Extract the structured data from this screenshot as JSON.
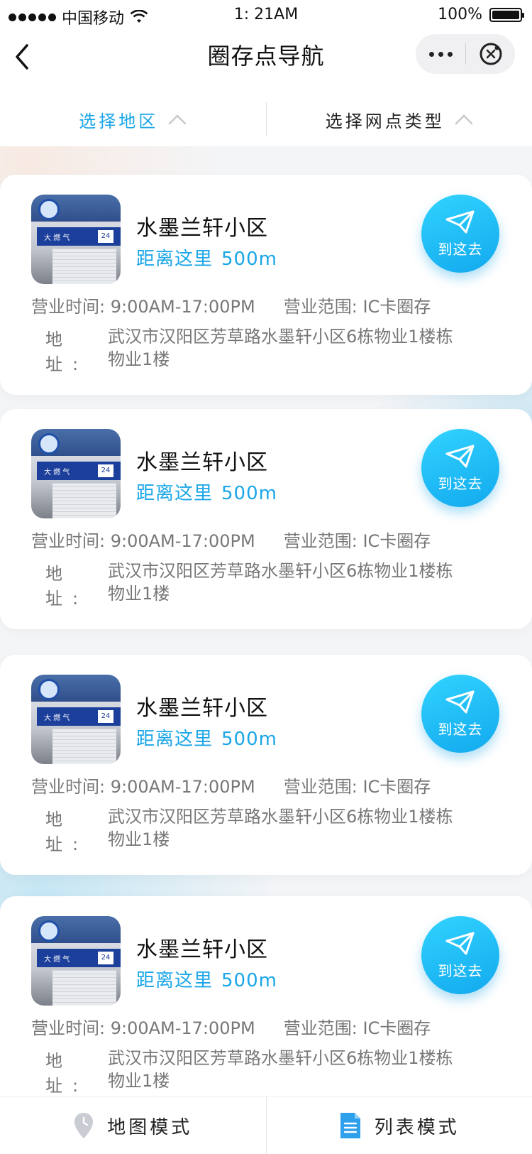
{
  "status_bar": {
    "carrier": "中国移动",
    "time": "1: 21AM",
    "battery": "100%",
    "battery_level": 1.0
  },
  "nav": {
    "title": "圈存点导航"
  },
  "filters": [
    {
      "label": "选择地区",
      "active": true
    },
    {
      "label": "选择网点类型",
      "active": false
    }
  ],
  "cards": [
    {
      "name": "水墨兰轩小区",
      "distance_label": "距离这里",
      "distance_value": "500m",
      "go_label": "到这去",
      "hours": "营业时间: 9:00AM-17:00PM",
      "scope": "营业范围: IC卡圈存",
      "address_label": "地址:",
      "address": "武汉市汉阳区芳草路水墨轩小区6栋物业1楼栋物业1楼",
      "photo_sign": "大 燃 气",
      "photo_badge": "24"
    },
    {
      "name": "水墨兰轩小区",
      "distance_label": "距离这里",
      "distance_value": "500m",
      "go_label": "到这去",
      "hours": "营业时间: 9:00AM-17:00PM",
      "scope": "营业范围: IC卡圈存",
      "address_label": "地址:",
      "address": "武汉市汉阳区芳草路水墨轩小区6栋物业1楼栋物业1楼",
      "photo_sign": "大 燃 气",
      "photo_badge": "24"
    },
    {
      "name": "水墨兰轩小区",
      "distance_label": "距离这里",
      "distance_value": "500m",
      "go_label": "到这去",
      "hours": "营业时间: 9:00AM-17:00PM",
      "scope": "营业范围: IC卡圈存",
      "address_label": "地址:",
      "address": "武汉市汉阳区芳草路水墨轩小区6栋物业1楼栋物业1楼",
      "photo_sign": "大 燃 气",
      "photo_badge": "24"
    },
    {
      "name": "水墨兰轩小区",
      "distance_label": "距离这里",
      "distance_value": "500m",
      "go_label": "到这去",
      "hours": "营业时间: 9:00AM-17:00PM",
      "scope": "营业范围: IC卡圈存",
      "address_label": "地址:",
      "address": "武汉市汉阳区芳草路水墨轩小区6栋物业1楼栋物业1楼",
      "photo_sign": "大 燃 气",
      "photo_badge": "24"
    }
  ],
  "bottom_tabs": [
    {
      "label": "地图模式",
      "icon": "map-pin-icon"
    },
    {
      "label": "列表模式",
      "icon": "document-list-icon"
    }
  ],
  "colors": {
    "accent": "#1aa6e8",
    "text_secondary": "#777777"
  }
}
